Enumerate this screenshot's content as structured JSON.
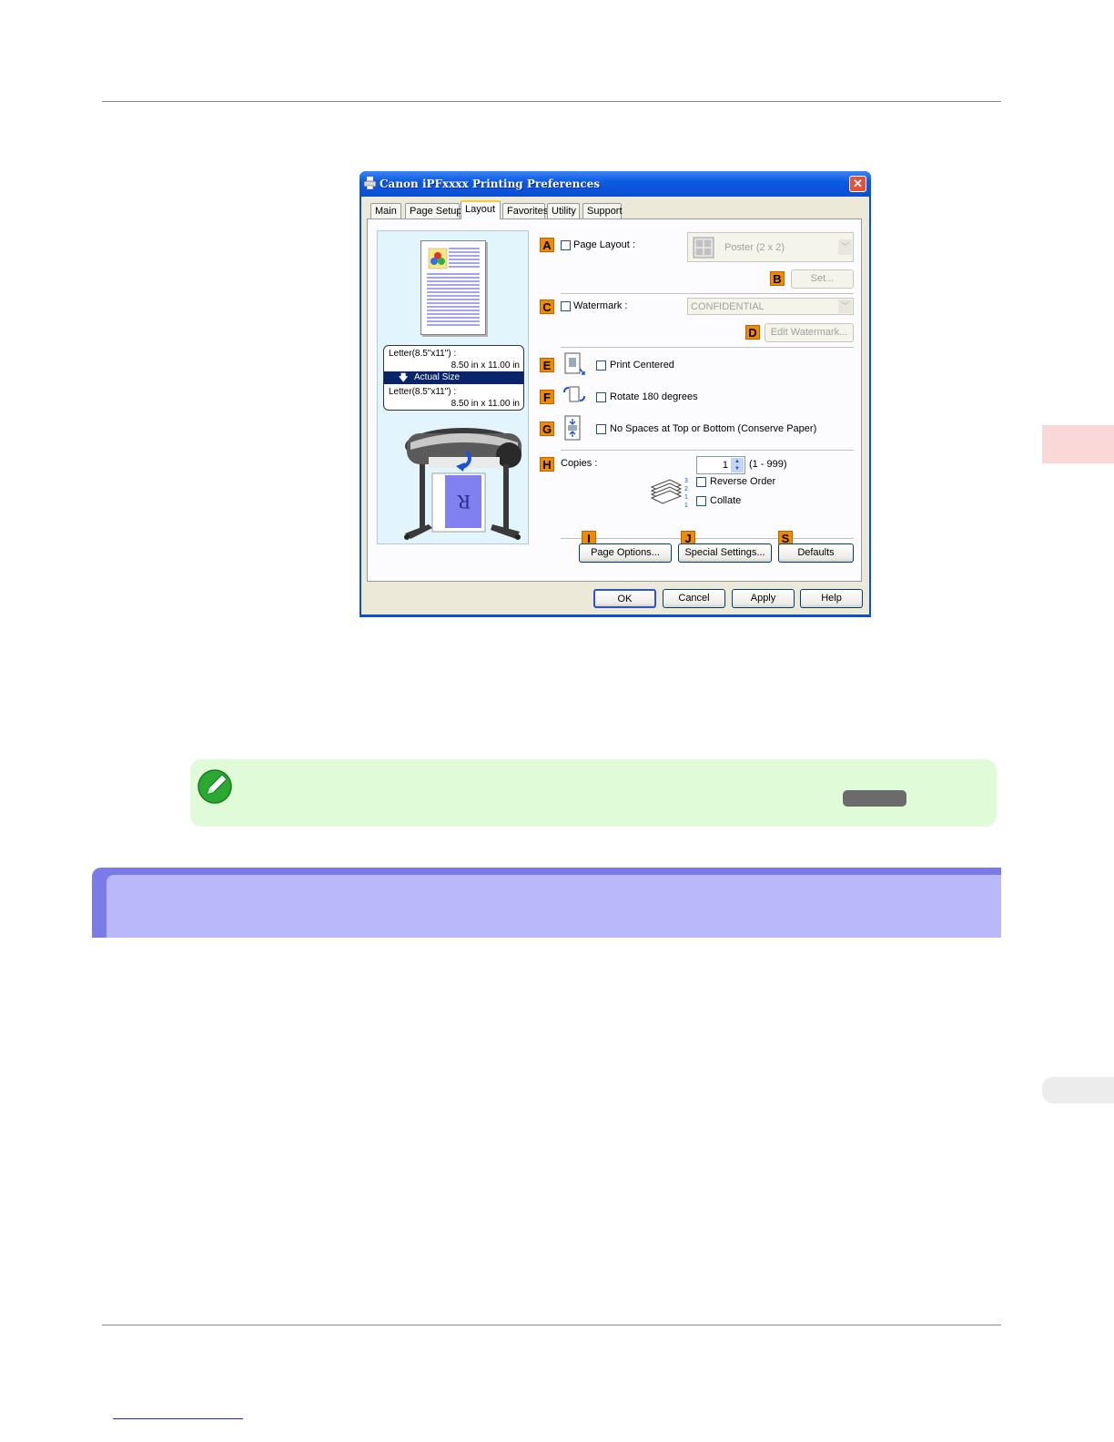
{
  "dialog": {
    "title": "Canon iPFxxxx Printing Preferences",
    "close_glyph": "✕",
    "tabs": [
      "Main",
      "Page Setup",
      "Layout",
      "Favorites",
      "Utility",
      "Support"
    ],
    "active_tab": "Layout",
    "preview": {
      "line1": "Letter(8.5\"x11\") :",
      "line2": "8.50 in x 11.00 in",
      "actual_size": "Actual Size",
      "line3": "Letter(8.5\"x11\") :",
      "line4": "8.50 in x 11.00 in",
      "poster_letter": "R"
    },
    "labels": {
      "A": "A",
      "B": "B",
      "C": "C",
      "D": "D",
      "E": "E",
      "F": "F",
      "G": "G",
      "H": "H",
      "I": "I",
      "J": "J",
      "S": "S"
    },
    "page_layout": {
      "label": "Page Layout :",
      "checked": false,
      "value": "Poster (2 x 2)"
    },
    "set_button": "Set...",
    "watermark": {
      "label": "Watermark :",
      "checked": false,
      "value": "CONFIDENTIAL"
    },
    "edit_watermark_button": "Edit Watermark...",
    "print_centered": "Print Centered",
    "rotate_180": "Rotate 180 degrees",
    "no_spaces": "No Spaces at Top or Bottom (Conserve Paper)",
    "copies": {
      "label": "Copies :",
      "value": "1",
      "range": "(1 - 999)"
    },
    "reverse_order": "Reverse Order",
    "collate": "Collate",
    "page_options_button": "Page Options...",
    "special_settings_button": "Special Settings...",
    "defaults_button": "Defaults",
    "ok_button": "OK",
    "cancel_button": "Cancel",
    "apply_button": "Apply",
    "help_button": "Help"
  },
  "colors": {
    "titlebar": "#0d5be3",
    "label_orange": "#f08a00",
    "note_bg": "#e0fbd7",
    "section_border": "#7b7be8",
    "section_fill": "#b8b8fa"
  }
}
